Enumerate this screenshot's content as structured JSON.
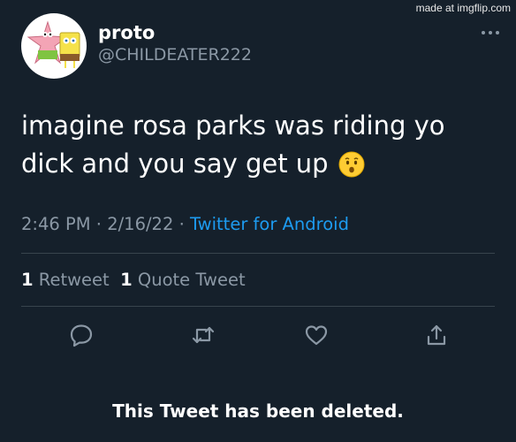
{
  "watermark": "made at imgflip.com",
  "tweet": {
    "display_name": "proto",
    "handle": "@CHILDEATER222",
    "text": "imagine rosa parks was riding yo dick and you say get up",
    "time": "2:46 PM",
    "date": "2/16/22",
    "source": "Twitter for Android",
    "retweets_count": "1",
    "retweets_label": "Retweet",
    "quotes_count": "1",
    "quotes_label": "Quote Tweet"
  },
  "icons": {
    "more": "more-dots-icon",
    "emoji": "hushed-face-emoji",
    "reply": "reply-icon",
    "retweet": "retweet-icon",
    "like": "like-icon",
    "share": "share-icon"
  },
  "deleted_banner": "This Tweet has been deleted.",
  "colors": {
    "background": "#15202b",
    "secondary_text": "#8b98a5",
    "link": "#1d9bf0",
    "divider": "#38444d"
  }
}
